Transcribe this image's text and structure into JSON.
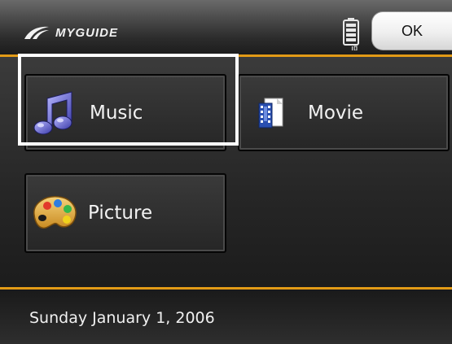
{
  "header": {
    "brand": "MYGUIDE",
    "ok_label": "OK",
    "battery_icon": "battery-icon"
  },
  "menu": {
    "items": [
      {
        "label": "Music",
        "icon": "music-note-icon",
        "selected": true
      },
      {
        "label": "Movie",
        "icon": "film-document-icon",
        "selected": false
      },
      {
        "label": "Picture",
        "icon": "paint-palette-icon",
        "selected": false
      }
    ]
  },
  "footer": {
    "date": "Sunday January 1, 2006"
  },
  "colors": {
    "accent_line": "#e29a16",
    "selection": "#ffffff",
    "text": "#f2f2f2"
  }
}
